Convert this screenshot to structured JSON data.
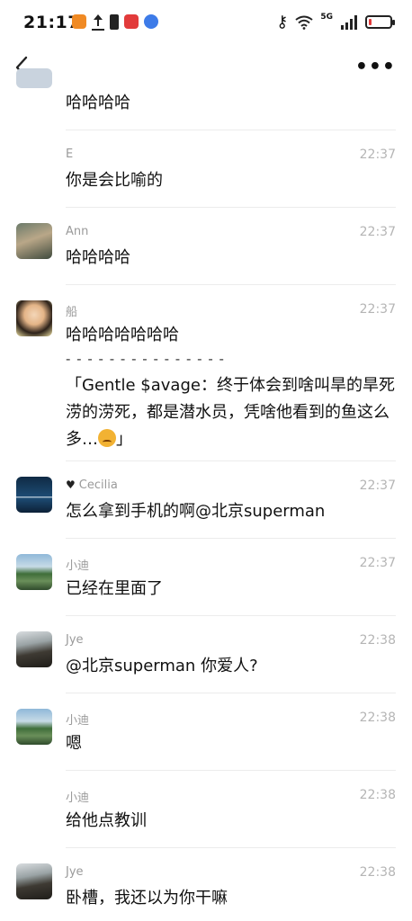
{
  "status_bar": {
    "time": "21:17",
    "network": "5G",
    "colors": {
      "battery_low": "#e23b3b"
    },
    "battery_level": 0.15
  },
  "nav": {
    "back_icon": "chevron-left-icon",
    "more_label": "•••"
  },
  "messages": [
    {
      "sender": "",
      "time": "",
      "text": "哈哈哈哈",
      "avatar": "partial-avatar"
    },
    {
      "sender": "E",
      "time": "22:37",
      "text": "你是会比喻的",
      "avatar": "none"
    },
    {
      "sender": "Ann",
      "time": "22:37",
      "text": "哈哈哈哈",
      "avatar": "photo-avatar"
    },
    {
      "sender": "船",
      "time": "22:37",
      "text": "哈哈哈哈哈哈哈",
      "quote_sep": "- - - - - - - - - - - - - - -",
      "quote": "「Gentle $avage：终于体会到啥叫旱的旱死涝的涝死，都是潜水员，凭啥他看到的鱼这么多…",
      "quote_end": "」",
      "avatar": "photo-avatar"
    },
    {
      "sender": "Cecilia",
      "time": "22:37",
      "text": "怎么拿到手机的啊@北京superman",
      "avatar": "photo-avatar",
      "heart": "♥"
    },
    {
      "sender": "小迪",
      "time": "22:37",
      "text": "已经在里面了",
      "avatar": "landscape-avatar"
    },
    {
      "sender": "Jye",
      "time": "22:38",
      "text": "@北京superman 你爱人?",
      "avatar": "landscape-avatar"
    },
    {
      "sender": "小迪",
      "time": "22:38",
      "text": "嗯",
      "avatar": "landscape-avatar"
    },
    {
      "sender": "小迪",
      "time": "22:38",
      "text": "给他点教训",
      "avatar": "none"
    },
    {
      "sender": "Jye",
      "time": "22:38",
      "text": "卧槽，我还以为你干嘛",
      "avatar": "landscape-avatar"
    }
  ]
}
